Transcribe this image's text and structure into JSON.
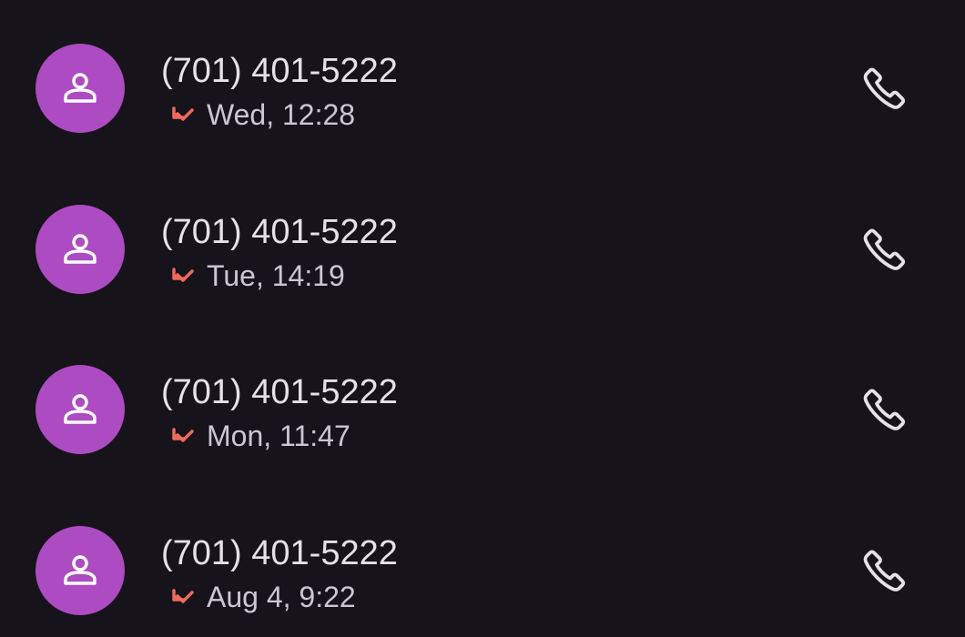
{
  "colors": {
    "background": "#16131a",
    "avatar": "#ad4bc2",
    "avatar_glyph": "#ffffff",
    "missed_call": "#ef6a5a",
    "primary_text": "#e6e1e9",
    "secondary_text": "#cdc6d1",
    "phone_icon": "#e6e1e9"
  },
  "calls": [
    {
      "number": "(701) 401-5222",
      "time": "Wed, 12:28",
      "status_icon": "missed-call-icon",
      "action_icon": "phone-icon"
    },
    {
      "number": "(701) 401-5222",
      "time": "Tue, 14:19",
      "status_icon": "missed-call-icon",
      "action_icon": "phone-icon"
    },
    {
      "number": "(701) 401-5222",
      "time": "Mon, 11:47",
      "status_icon": "missed-call-icon",
      "action_icon": "phone-icon"
    },
    {
      "number": "(701) 401-5222",
      "time": "Aug 4, 9:22",
      "status_icon": "missed-call-icon",
      "action_icon": "phone-icon"
    }
  ]
}
